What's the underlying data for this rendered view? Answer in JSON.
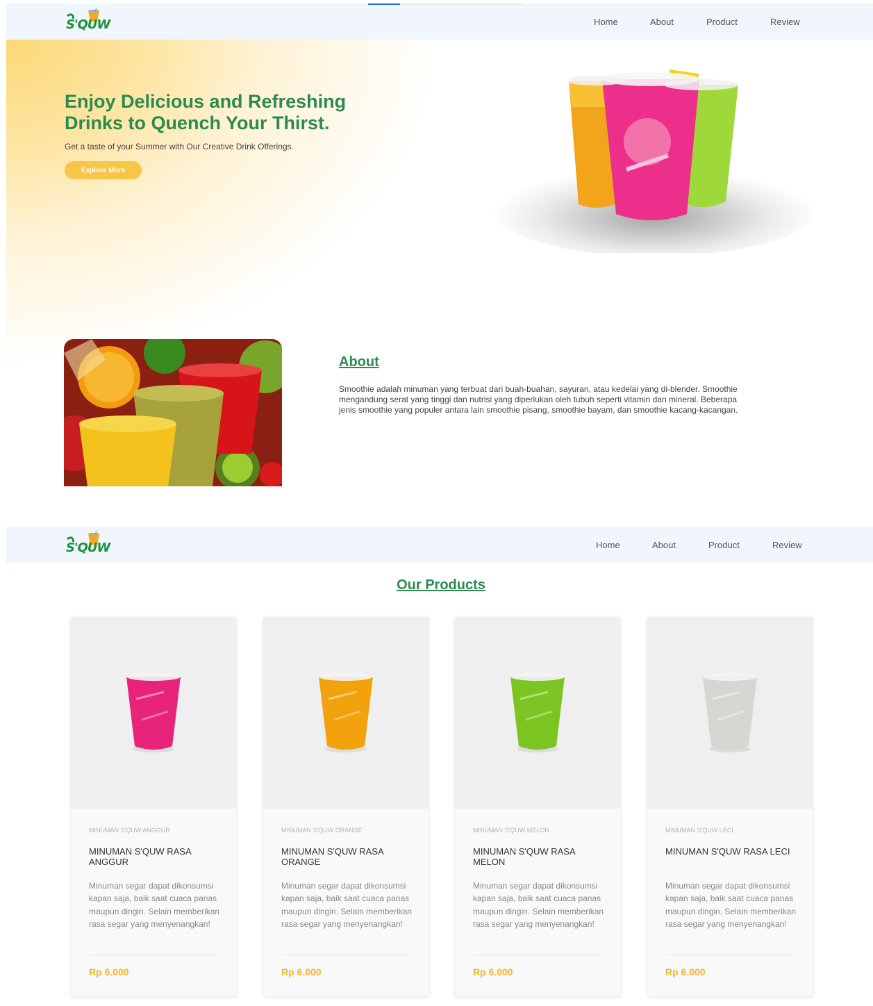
{
  "brand": {
    "logo_text": "S'QUW"
  },
  "nav": {
    "home": "Home",
    "about": "About",
    "product": "Product",
    "review": "Review"
  },
  "hero": {
    "title": "Enjoy Delicious and Refreshing Drinks to Quench Your Thirst.",
    "subtitle": "Get a taste of your Summer with Our Creative Drink Offerings.",
    "cta": "Explore More"
  },
  "about": {
    "heading": "About",
    "text": "Smoothie adalah minuman yang terbuat dari buah-buahan, sayuran, atau kedelai yang di-blender. Smoothie mengandung serat yang tinggi dan nutrisi yang diperlukan oleh tubuh seperti vitamin dan mineral. Beberapa jenis smoothie yang populer antara lain smoothie pisang, smoothie bayam, dan smoothie kacang-kacangan."
  },
  "products": {
    "heading": "Our Products",
    "items": [
      {
        "category": "MINUMAN S'QUW ANGGUR",
        "title": "MINUMAN S'QUW RASA ANGGUR",
        "desc": "Minuman segar dapat dikonsumsi kapan saja, baik saat cuaca panas maupun dingin. Selain memberikan rasa segar yang menyenangkan!",
        "price": "Rp 6.000",
        "color": "#e8237a"
      },
      {
        "category": "MINUMAN S'QUW ORANGE",
        "title": "MINUMAN S'QUW RASA ORANGE",
        "desc": "Minuman segar dapat dikonsumsi kapan saja, baik saat cuaca panas maupun dingin. Selain memberikan rasa segar yang menyenangkan!",
        "price": "Rp 6.000",
        "color": "#f2a20c"
      },
      {
        "category": "MINUMAN S'QUW MELON",
        "title": "MINUMAN S'QUW RASA MELON",
        "desc": "Minuman segar dapat dikonsumsi kapan saja, baik saat cuaca panas maupun dingin. Selain memberikan rasa segar yang menyenangkan!",
        "price": "Rp 6.000",
        "color": "#7cc422"
      },
      {
        "category": "MINUMAN S'QUW LECI",
        "title": "MINUMAN S'QUW RASA LECI",
        "desc": "Minuman segar dapat dikonsumsi kapan saja, baik saat cuaca panas maupun dingin. Selain memberikan rasa segar yang menyenangkan!",
        "price": "Rp 6.000",
        "color": "#d6d6d2"
      }
    ]
  },
  "colors": {
    "accent_green": "#2a8a50",
    "accent_yellow": "#f6c64a",
    "price": "#f3b531",
    "nav_bg": "#f0f6fc"
  }
}
